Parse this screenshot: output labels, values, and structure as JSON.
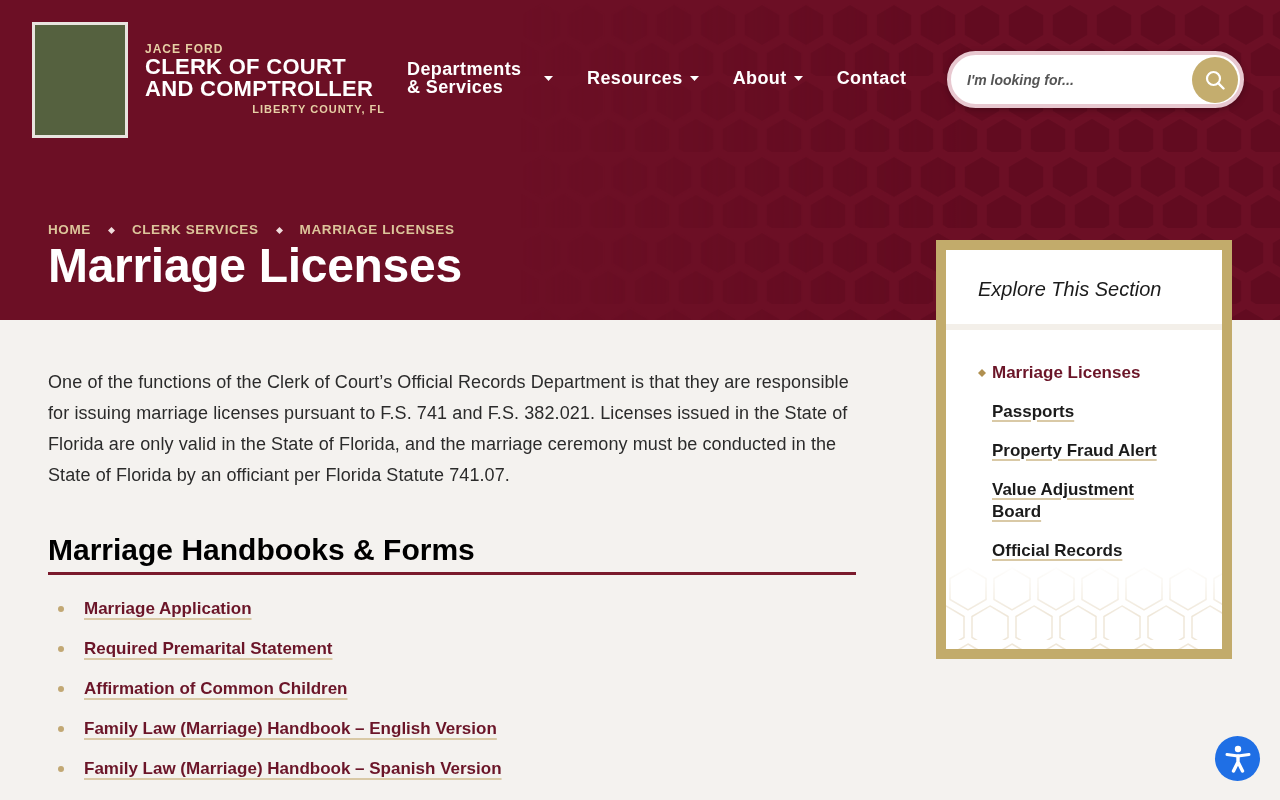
{
  "header": {
    "brand": {
      "name": "JACE FORD",
      "title": [
        "CLERK OF COURT",
        "AND COMPTROLLER"
      ],
      "county": "LIBERTY COUNTY, FL"
    },
    "nav": [
      {
        "label": "Departments & Services",
        "has_menu": true
      },
      {
        "label": "Resources",
        "has_menu": true
      },
      {
        "label": "About",
        "has_menu": true
      },
      {
        "label": "Contact",
        "has_menu": false
      }
    ],
    "search": {
      "placeholder": "I'm looking for..."
    }
  },
  "breadcrumbs": [
    "HOME",
    "CLERK SERVICES",
    "MARRIAGE LICENSES"
  ],
  "page_title": "Marriage Licenses",
  "intro": "One of the functions of the Clerk of Court’s Official Records Department is that they are responsible for issuing marriage licenses pursuant to F.S. 741 and F.S. 382.021. Licenses issued in the State of Florida are only valid in the State of Florida, and the marriage ceremony must be conducted in the State of Florida by an officiant per Florida Statute 741.07.",
  "forms_section": {
    "heading": "Marriage Handbooks & Forms",
    "links": [
      "Marriage Application",
      "Required Premarital Statement",
      "Affirmation of Common Children",
      "Family Law (Marriage) Handbook – English Version",
      "Family Law (Marriage) Handbook – Spanish Version"
    ]
  },
  "sidebar": {
    "title": "Explore This Section",
    "items": [
      {
        "label": "Marriage Licenses",
        "selected": true
      },
      {
        "label": "Passports",
        "selected": false
      },
      {
        "label": "Property Fraud Alert",
        "selected": false
      },
      {
        "label": "Value Adjustment Board",
        "selected": false
      },
      {
        "label": "Official Records",
        "selected": false
      }
    ]
  }
}
